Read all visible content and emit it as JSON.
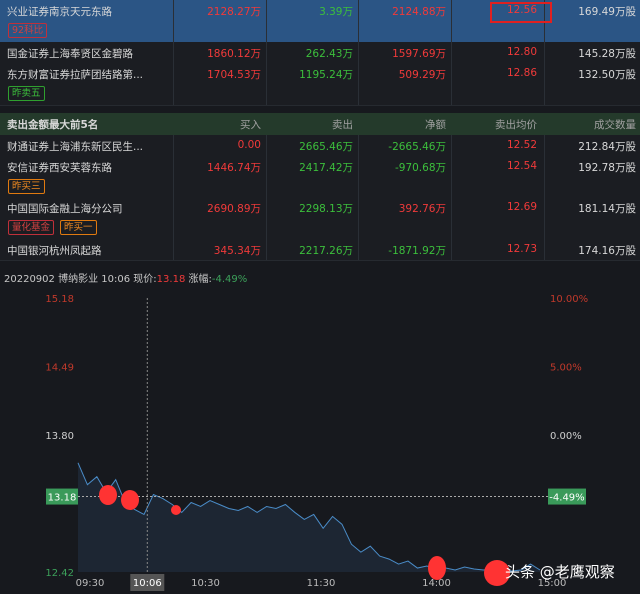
{
  "buy_rows": [
    {
      "name": "兴业证券南京天元东路",
      "buy": "2128.27万",
      "sell": "3.39万",
      "net": "2124.88万",
      "avg": "12.56",
      "vol": "169.49万股",
      "tags": [
        {
          "t": "92科比",
          "c": "r"
        }
      ],
      "selected": true
    },
    {
      "name": "国金证券上海奉贤区金碧路",
      "buy": "1860.12万",
      "sell": "262.43万",
      "net": "1597.69万",
      "avg": "12.80",
      "vol": "145.28万股",
      "tags": []
    },
    {
      "name": "东方财富证券拉萨团结路第...",
      "buy": "1704.53万",
      "sell": "1195.24万",
      "net": "509.29万",
      "avg": "12.86",
      "vol": "132.50万股",
      "tags": [
        {
          "t": "昨卖五",
          "c": "g"
        }
      ]
    }
  ],
  "sell_header": {
    "title": "卖出金额最大前5名",
    "buy": "买入",
    "sell": "卖出",
    "net": "净额",
    "avg": "卖出均价",
    "vol": "成交数量"
  },
  "sell_rows": [
    {
      "name": "财通证券上海浦东新区民生...",
      "buy": "0.00",
      "sell": "2665.46万",
      "net": "-2665.46万",
      "avg": "12.52",
      "vol": "212.84万股",
      "tags": []
    },
    {
      "name": "安信证券西安芙蓉东路",
      "buy": "1446.74万",
      "sell": "2417.42万",
      "net": "-970.68万",
      "avg": "12.54",
      "vol": "192.78万股",
      "tags": [
        {
          "t": "昨买三",
          "c": "o"
        }
      ]
    },
    {
      "name": "中国国际金融上海分公司",
      "buy": "2690.89万",
      "sell": "2298.13万",
      "net": "392.76万",
      "avg": "12.69",
      "vol": "181.14万股",
      "tags": [
        {
          "t": "量化基金",
          "c": "r"
        },
        {
          "t": "昨买一",
          "c": "o"
        }
      ]
    },
    {
      "name": "中国银河杭州凤起路",
      "buy": "345.34万",
      "sell": "2217.26万",
      "net": "-1871.92万",
      "avg": "12.73",
      "vol": "174.16万股",
      "tags": []
    }
  ],
  "info": {
    "date": "20220902",
    "stock": "博纳影业",
    "time": "10:06",
    "price_label": "现价:",
    "price": "13.18",
    "chg_label": "涨幅:",
    "chg": "-4.49%"
  },
  "watermark": "头条 @老鹰观察",
  "chart_data": {
    "type": "line",
    "y_ticks": [
      "15.18",
      "14.49",
      "13.80",
      "12.42"
    ],
    "y_right_ticks": [
      "10.00%",
      "5.00%",
      "0.00%"
    ],
    "ylim": [
      12.42,
      15.18
    ],
    "x_ticks": [
      "09:30",
      "10:30",
      "11:30",
      "14:00",
      "15:00"
    ],
    "cursor": {
      "time": "10:06",
      "price": "13.18",
      "pct": "-4.49%"
    },
    "prices": [
      13.52,
      13.3,
      13.38,
      13.22,
      13.35,
      13.12,
      13.05,
      13.0,
      13.2,
      13.16,
      13.1,
      13.02,
      13.12,
      13.08,
      13.14,
      13.1,
      13.06,
      13.04,
      13.08,
      13.02,
      13.08,
      13.06,
      13.1,
      13.02,
      12.95,
      13.0,
      12.86,
      12.98,
      12.9,
      12.7,
      12.62,
      12.68,
      12.58,
      12.55,
      12.5,
      12.53,
      12.46,
      12.48,
      12.45,
      12.46,
      12.44,
      12.47,
      12.45,
      12.44,
      12.45,
      12.44,
      12.43,
      12.44,
      12.5,
      12.44
    ]
  }
}
